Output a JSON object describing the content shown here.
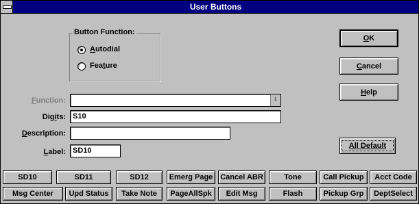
{
  "window": {
    "title": "User Buttons"
  },
  "group": {
    "title": "Button Function:"
  },
  "radios": [
    {
      "pre": "",
      "u": "A",
      "post": "utodial",
      "selected": true
    },
    {
      "pre": "Fea",
      "u": "t",
      "post": "ure",
      "selected": false
    }
  ],
  "form": {
    "function": {
      "pre": "",
      "u": "F",
      "post": "unction:",
      "value": ""
    },
    "digits": {
      "pre": "Dig",
      "u": "i",
      "post": "ts:",
      "value": "S10"
    },
    "description": {
      "pre": "",
      "u": "D",
      "post": "escription:",
      "value": ""
    },
    "label": {
      "pre": "",
      "u": "L",
      "post": "abel:",
      "value": "SD10"
    }
  },
  "actions": {
    "ok": {
      "pre": "",
      "u": "O",
      "post": "K"
    },
    "cancel": {
      "pre": "",
      "u": "C",
      "post": "ancel"
    },
    "help": {
      "pre": "",
      "u": "H",
      "post": "elp"
    },
    "all_default": "All Default"
  },
  "buttons_row1": [
    "SD10",
    "SD11",
    "SD12",
    "Emerg Page",
    "Cancel ABR",
    "Tone",
    "Call Pickup",
    "Acct Code"
  ],
  "buttons_row2": [
    "Msg Center",
    "Upd Status",
    "Take Note",
    "PageAllSpk",
    "Edit Msg",
    "Flash",
    "Pickup Grp",
    "DeptSelect"
  ]
}
